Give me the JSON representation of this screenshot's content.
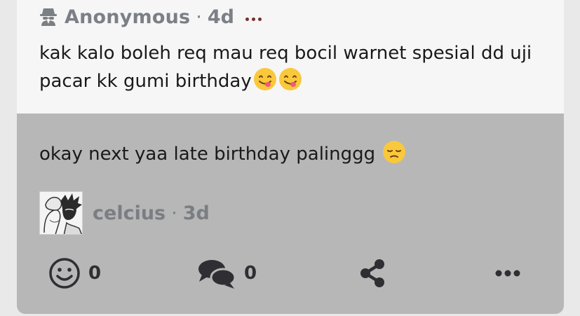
{
  "question": {
    "author": "Anonymous",
    "separator": "·",
    "time": "4d",
    "text": "kak kalo boleh req mau req bocil warnet spesial dd uji pacar kk gumi birthday",
    "icons": {
      "author": "spy-icon",
      "menu": "more-dots-icon",
      "emoji": "savoring-face-emoji"
    }
  },
  "answer": {
    "text": "okay next yaa late birthday palinggg",
    "author": "celcius",
    "separator": "·",
    "time": "3d",
    "icons": {
      "emoji": "pensive-face-emoji"
    }
  },
  "actions": {
    "reactions": {
      "icon": "smiley-icon",
      "count": "0"
    },
    "comments": {
      "icon": "comments-icon",
      "count": "0"
    },
    "share": {
      "icon": "share-icon"
    },
    "more": {
      "icon": "more-dots-icon"
    }
  },
  "colors": {
    "question_bg": "#f6f6f6",
    "answer_bg": "#b7b7b7",
    "meta_text": "#7b7f86",
    "menu_dots": "#7a2d2d",
    "action_icon": "#2f2f33"
  }
}
